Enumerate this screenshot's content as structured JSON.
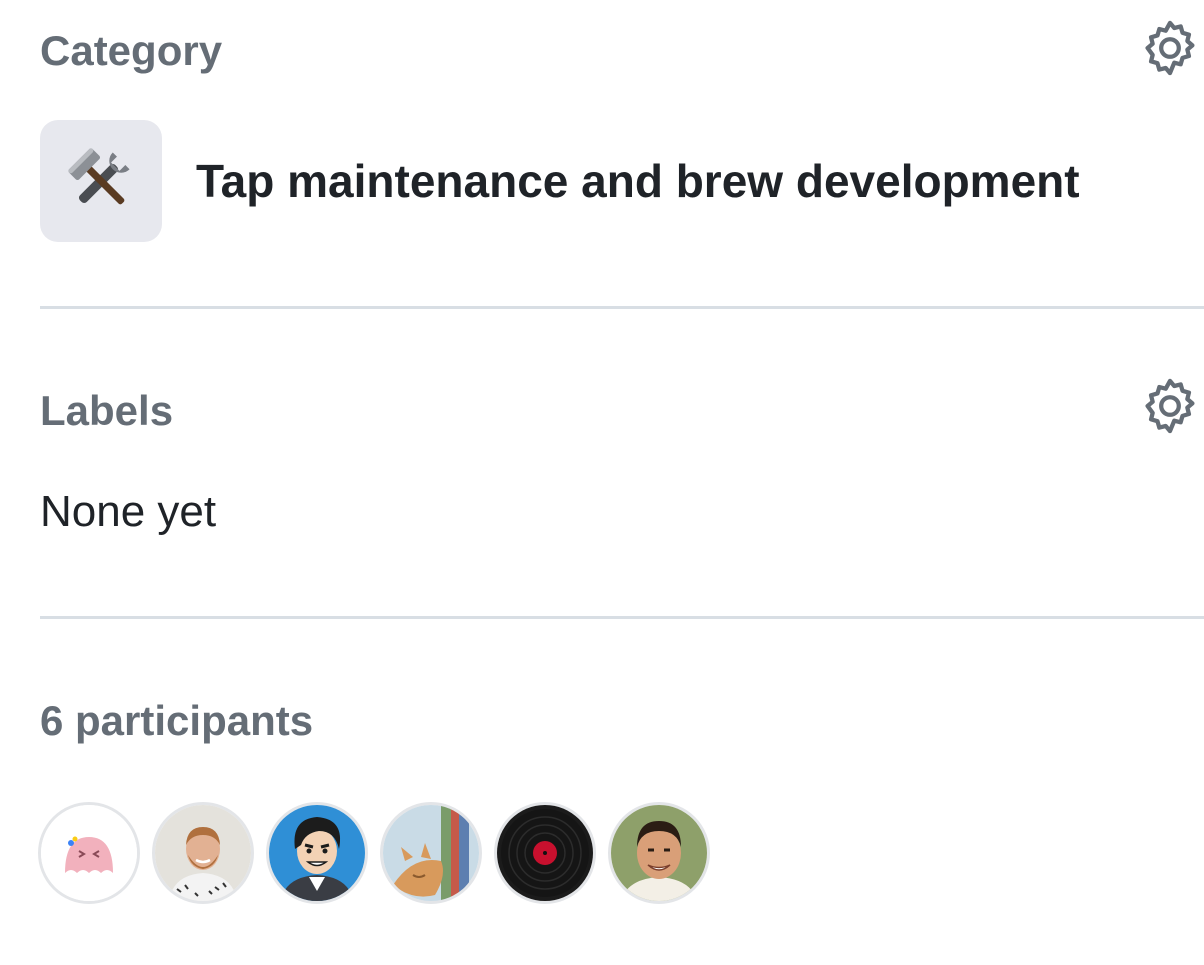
{
  "category": {
    "title": "Category",
    "name": "Tap maintenance and brew development",
    "emoji_icon": "hammer-and-wrench-icon",
    "settings_icon": "gear-icon"
  },
  "labels": {
    "title": "Labels",
    "value": "None yet",
    "settings_icon": "gear-icon"
  },
  "participants": {
    "title": "6 participants",
    "avatars": [
      {
        "icon": "pink-ghost-avatar"
      },
      {
        "icon": "bearded-man-avatar"
      },
      {
        "icon": "cartoon-man-avatar"
      },
      {
        "icon": "cat-avatar"
      },
      {
        "icon": "vinyl-record-avatar"
      },
      {
        "icon": "smiling-man-avatar"
      }
    ]
  },
  "colors": {
    "muted_text": "#656d76",
    "primary_text": "#1f2328",
    "divider": "#d8dee4",
    "emoji_background": "#e7e8ee"
  }
}
